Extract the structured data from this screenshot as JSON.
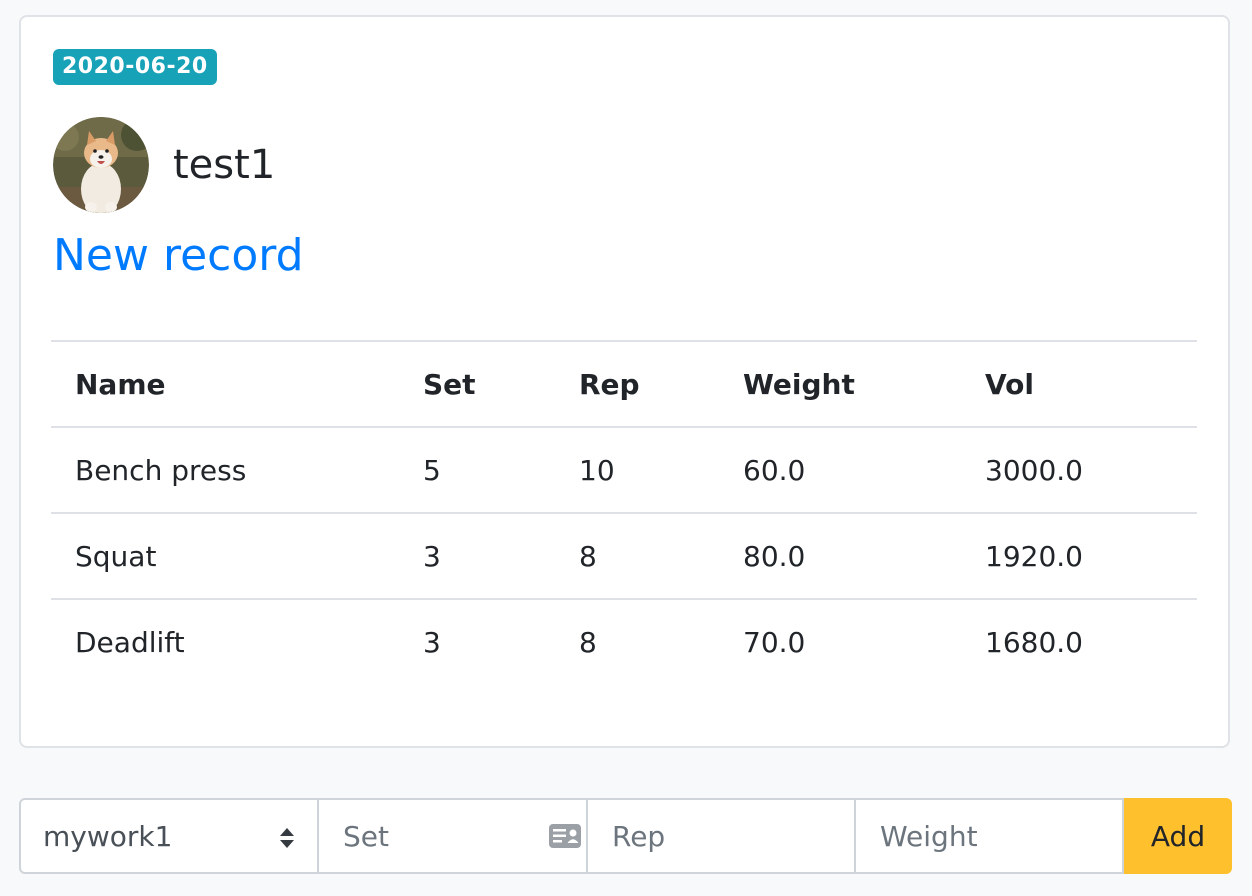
{
  "record": {
    "date_badge": "2020-06-20",
    "username": "test1",
    "new_record_link": "New record"
  },
  "table": {
    "headers": [
      "Name",
      "Set",
      "Rep",
      "Weight",
      "Vol"
    ],
    "rows": [
      [
        "Bench press",
        "5",
        "10",
        "60.0",
        "3000.0"
      ],
      [
        "Squat",
        "3",
        "8",
        "80.0",
        "1920.0"
      ],
      [
        "Deadlift",
        "3",
        "8",
        "70.0",
        "1680.0"
      ]
    ]
  },
  "form": {
    "workout_select_value": "mywork1",
    "set_placeholder": "Set",
    "rep_placeholder": "Rep",
    "weight_placeholder": "Weight",
    "add_label": "Add"
  },
  "icons": {
    "select_arrows": "sort-arrows-icon",
    "set_field_icon": "contact-card-icon"
  },
  "colors": {
    "badge_bg": "#17a2b8",
    "link": "#007bff",
    "add_button": "#ffc02e"
  }
}
